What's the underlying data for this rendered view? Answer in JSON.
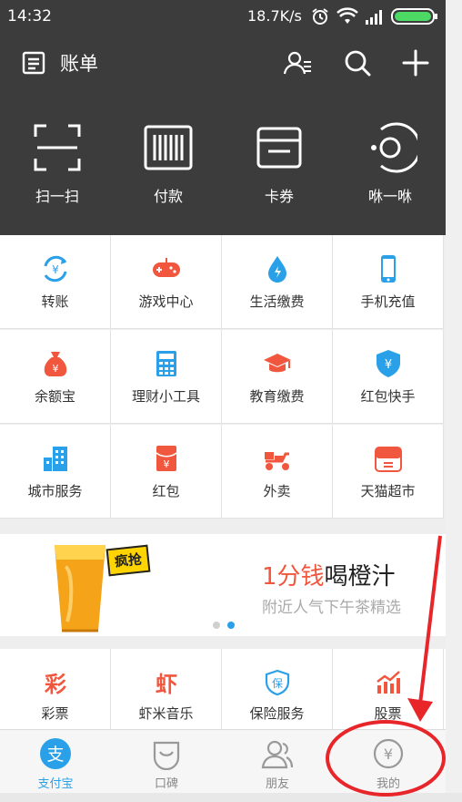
{
  "status": {
    "time": "14:32",
    "speed": "18.7K/s"
  },
  "header": {
    "title": "账单"
  },
  "actions": [
    {
      "label": "扫一扫",
      "icon": "scan-icon"
    },
    {
      "label": "付款",
      "icon": "barcode-icon"
    },
    {
      "label": "卡券",
      "icon": "card-wallet-icon"
    },
    {
      "label": "咻一咻",
      "icon": "shake-icon"
    }
  ],
  "services": [
    {
      "label": "转账",
      "icon": "transfer-icon",
      "color": "#2aa0e8"
    },
    {
      "label": "游戏中心",
      "icon": "gamepad-icon",
      "color": "#f0573e"
    },
    {
      "label": "生活缴费",
      "icon": "utility-drop-icon",
      "color": "#2aa0e8"
    },
    {
      "label": "手机充值",
      "icon": "mobile-phone-icon",
      "color": "#2aa0e8"
    },
    {
      "label": "余额宝",
      "icon": "money-bag-icon",
      "color": "#f0573e"
    },
    {
      "label": "理财小工具",
      "icon": "calculator-icon",
      "color": "#2aa0e8"
    },
    {
      "label": "教育缴费",
      "icon": "graduation-cap-icon",
      "color": "#f0573e"
    },
    {
      "label": "红包快手",
      "icon": "shield-yen-icon",
      "color": "#2aa0e8"
    },
    {
      "label": "城市服务",
      "icon": "city-buildings-icon",
      "color": "#2aa0e8"
    },
    {
      "label": "红包",
      "icon": "red-envelope-icon",
      "color": "#f0573e"
    },
    {
      "label": "外卖",
      "icon": "delivery-scooter-icon",
      "color": "#f0573e"
    },
    {
      "label": "天猫超市",
      "icon": "tmall-market-icon",
      "color": "#f0573e"
    }
  ],
  "banner": {
    "badge": "疯抢",
    "headline_highlight": "1分钱",
    "headline_rest": "喝橙汁",
    "subtitle": "附近人气下午茶精选"
  },
  "services2": [
    {
      "label": "彩票",
      "glyph": "彩",
      "color": "#f0573e"
    },
    {
      "label": "虾米音乐",
      "glyph": "虾",
      "color": "#f0573e"
    },
    {
      "label": "保险服务",
      "glyph": "保",
      "color": "#2aa0e8"
    },
    {
      "label": "股票",
      "icon": "stock-chart-icon",
      "color": "#f0573e"
    }
  ],
  "tabs": [
    {
      "label": "支付宝",
      "icon": "alipay-icon",
      "active": true,
      "glyph": "支"
    },
    {
      "label": "口碑",
      "icon": "koubei-bag-icon"
    },
    {
      "label": "朋友",
      "icon": "friends-icon"
    },
    {
      "label": "我的",
      "icon": "my-wealth-icon",
      "glyph": "¥"
    }
  ],
  "colors": {
    "accent": "#2aa0e8",
    "brand_red": "#f0573e",
    "header_bg": "#3c3c3c",
    "annotation_red": "#e8262a"
  }
}
